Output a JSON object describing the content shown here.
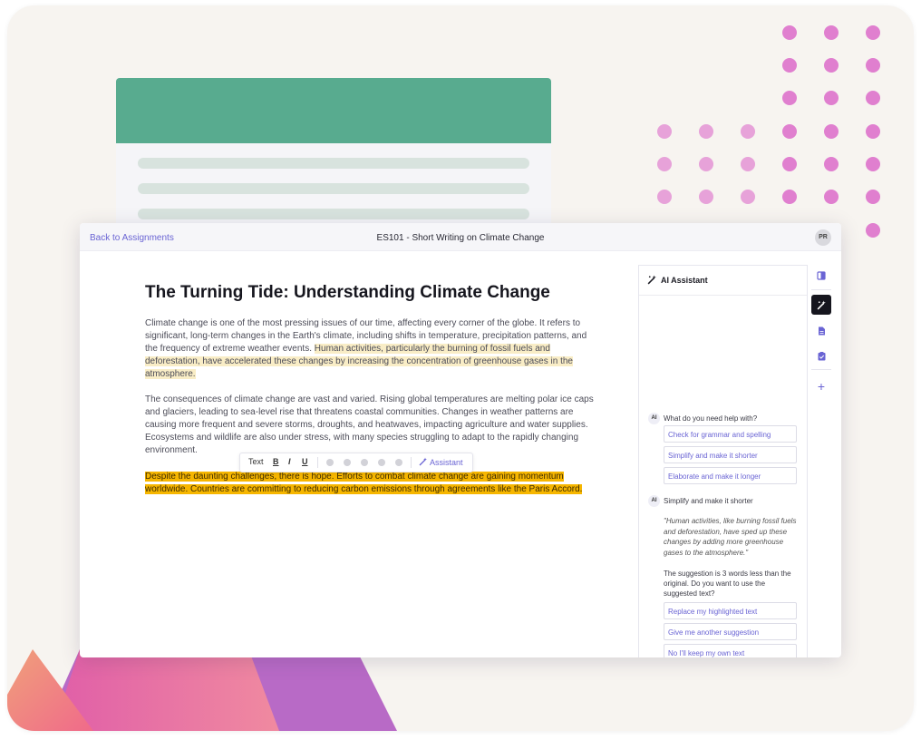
{
  "colors": {
    "accent": "#6a64d4",
    "highlight_soft": "#f9edc6",
    "highlight_strong": "#f6b600",
    "header_green": "#58ab8f",
    "dot_pink": "#e07fcf"
  },
  "header": {
    "back_link": "Back to Assignments",
    "title": "ES101 - Short Writing on Climate Change",
    "avatar_initials": "PR"
  },
  "essay": {
    "title": "The Turning Tide: Understanding Climate Change",
    "p1_plain": "Climate change is one of the most pressing issues of our time, affecting every corner of the globe. It refers to significant, long-term changes in the Earth's climate, including shifts in temperature, precipitation patterns, and the frequency of extreme weather events. ",
    "p1_highlight": "Human activities, particularly the burning of fossil fuels and deforestation, have accelerated these changes by increasing the concentration of greenhouse gases in the atmosphere.",
    "p2": "The consequences of climate change are vast and varied. Rising global temperatures are melting polar ice caps and glaciers, leading to sea-level rise that threatens coastal communities. Changes in weather patterns are causing more frequent and severe storms, droughts, and heatwaves, impacting agriculture and water supplies. Ecosystems and wildlife are also under stress, with many species struggling to adapt to the rapidly changing environment.",
    "p3_highlight": "Despite the daunting challenges, there is hope. Efforts to combat climate change are gaining momentum worldwide. Countries are committing to reducing carbon emissions through agreements like the Paris Accord."
  },
  "toolbar": {
    "text_label": "Text",
    "bold": "B",
    "italic": "I",
    "underline": "U",
    "assistant_label": "Assistant"
  },
  "ai_panel": {
    "title": "AI Assistant",
    "badge": "AI",
    "prompt": "What do you need help with?",
    "options": [
      "Check for grammar and spelling",
      "Simplify and make it shorter",
      "Elaborate and make it longer"
    ],
    "user_choice": "Simplify and make it shorter",
    "suggestion": "\"Human activities, like burning fossil fuels and deforestation, have sped up these changes by adding more greenhouse gases to the atmosphere.\"",
    "note": "The suggestion is 3 words less than the original. Do you want to use the suggested text?",
    "actions": [
      "Replace my highlighted text",
      "Give me another suggestion",
      "No I'll keep my own text"
    ]
  },
  "rail": {
    "icons": [
      "panel-icon",
      "magic-wand-icon",
      "document-icon",
      "clipboard-check-icon",
      "plus-icon"
    ]
  }
}
